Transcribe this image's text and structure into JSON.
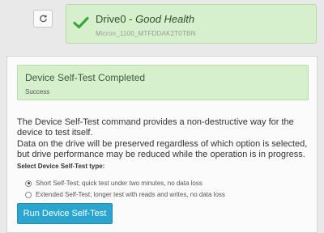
{
  "drive": {
    "name": "Drive0 - ",
    "health": "Good Health",
    "model": "Micron_1100_MTFDDAK2T0TBN"
  },
  "alert": {
    "title": "Device Self-Test Completed",
    "status": "Success"
  },
  "description": {
    "para1": "The Device Self-Test command provides a non-destructive way for the device to test itself.",
    "para2": "Data on the drive will be preserved regardless of which option is selected, but drive performance may be reduced while the operation is in progress."
  },
  "options": {
    "label": "Select Device Self-Test type:",
    "short": "Short Self-Test; quick test under two minutes, no data loss",
    "extended": "Extended Self-Test; longer test with reads and writes, no data loss",
    "selected": "short"
  },
  "run_button": "Run Device Self-Test",
  "colors": {
    "health_green": "#d6efcc",
    "check_green": "#3aa63a",
    "button_blue": "#2aa5d0"
  },
  "icons": {
    "refresh": "refresh-icon",
    "check": "check-icon"
  }
}
